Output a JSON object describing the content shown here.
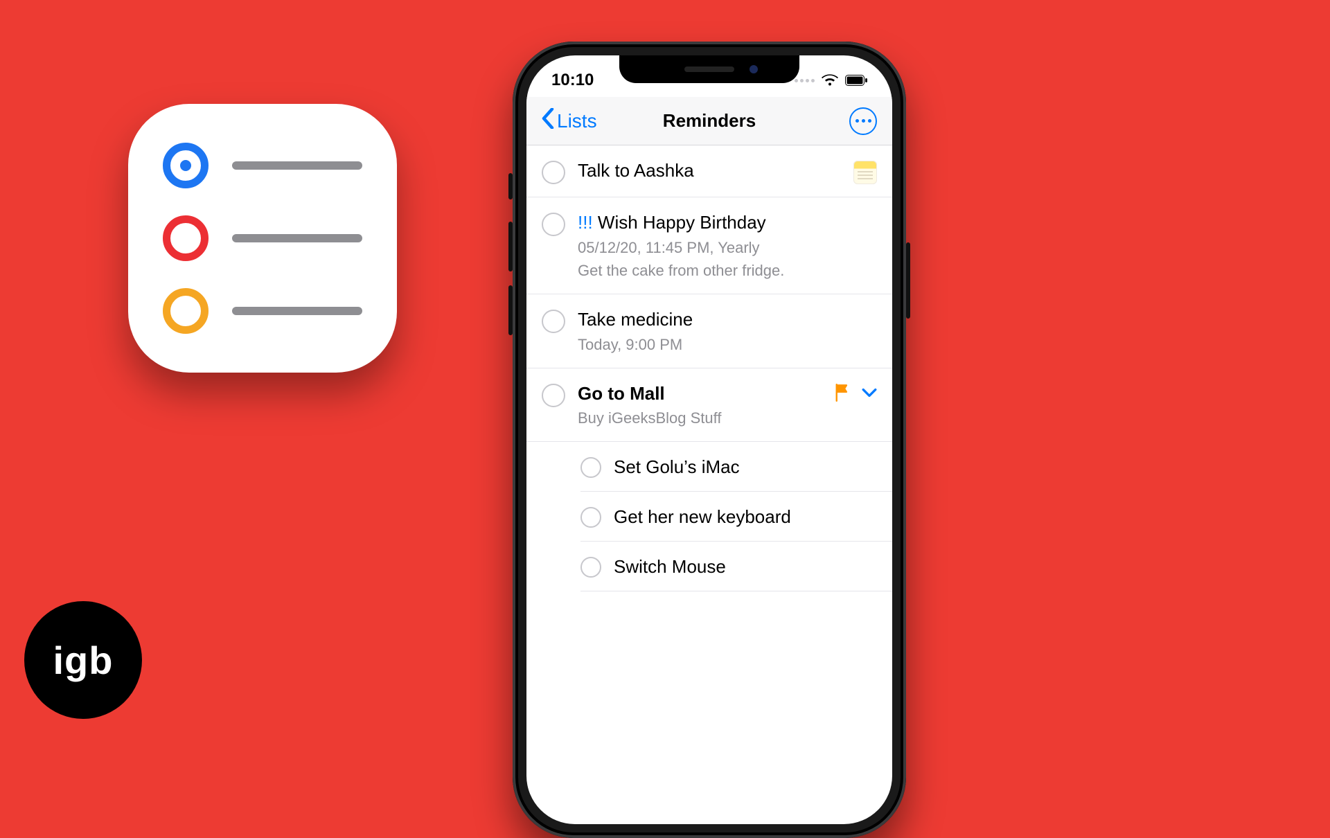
{
  "brand": {
    "logo_text": "iGB"
  },
  "app_icon": {
    "colors": [
      "#1d76f2",
      "#ec2f34",
      "#f5a623"
    ]
  },
  "status_bar": {
    "time": "10:10"
  },
  "nav": {
    "back_label": "Lists",
    "title": "Reminders"
  },
  "reminders": [
    {
      "id": "r1",
      "title": "Talk to Aashka",
      "has_notes_attachment": true
    },
    {
      "id": "r2",
      "priority_prefix": "!!! ",
      "title": "Wish Happy Birthday",
      "meta_line1": "05/12/20, 11:45 PM, Yearly",
      "meta_line2": "Get the cake from other fridge."
    },
    {
      "id": "r3",
      "title": "Take medicine",
      "meta_line1": "Today, 9:00 PM"
    },
    {
      "id": "r4",
      "title": "Go to Mall",
      "bold": true,
      "meta_line1": "Buy iGeeksBlog Stuff",
      "flagged": true,
      "expandable": true,
      "subtasks": [
        {
          "id": "r4a",
          "title": "Set Golu’s iMac"
        },
        {
          "id": "r4b",
          "title": "Get her new keyboard"
        },
        {
          "id": "r4c",
          "title": "Switch Mouse"
        }
      ]
    }
  ]
}
